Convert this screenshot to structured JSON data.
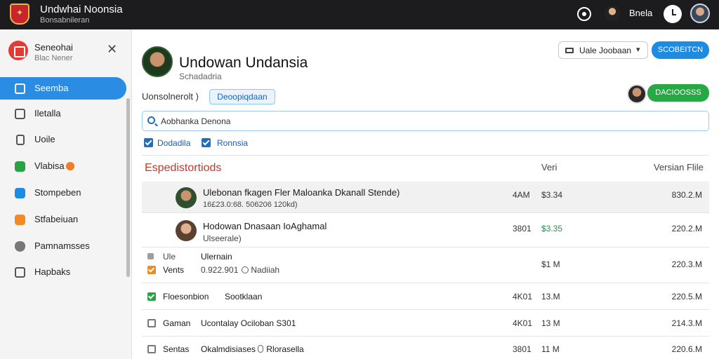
{
  "app": {
    "title": "Undwhai Noonsia",
    "subtitle": "Bonsabnileran",
    "user_label": "Bnela"
  },
  "sidebar": {
    "header_title": "Seneohai",
    "header_sub": "Blac Nener",
    "items": [
      {
        "label": "Seemba",
        "icon": "check-square-icon",
        "color": "#ffffff",
        "active": true
      },
      {
        "label": "Iletalla",
        "icon": "mail-icon",
        "color": "#555555"
      },
      {
        "label": "Uoile",
        "icon": "document-icon",
        "color": "#555555"
      },
      {
        "label": "Vlabisa",
        "icon": "checkmark-icon",
        "color": "#27a345",
        "badge": true
      },
      {
        "label": "Stompeben",
        "icon": "calendar-icon",
        "color": "#1d8ce0"
      },
      {
        "label": "Stfabeiuan",
        "icon": "tag-icon",
        "color": "#f08a24"
      },
      {
        "label": "Pamnamsses",
        "icon": "shield-icon",
        "color": "#666666"
      },
      {
        "label": "Hapbaks",
        "icon": "grid-icon",
        "color": "#555555"
      }
    ]
  },
  "main": {
    "title": "Undowan Undansia",
    "subtitle": "Schadadria",
    "dropdown_label": "Uale Joobaan",
    "primary_button": "SCOBEITCN",
    "green_button": "DACIOOSSS",
    "filter_label": "Uonsolnerolt )",
    "filter_chip": "Deoopiqdaan",
    "search_value": "Aobhanka Denona",
    "checks": [
      {
        "label": "Dodadila"
      },
      {
        "label": "Ronnsia"
      }
    ],
    "section_title": "Espedistortiods",
    "col_1": "Veri",
    "col_2": "Versian Flile"
  },
  "rows": [
    {
      "title": "Ulebonan fkagen Fler Maloanka Dkanall Stende)",
      "sub": "16£23.0:68. 506206 120kd)",
      "c1": "4AM",
      "c2": "$3.34",
      "c3": "830.2.M",
      "selected": true
    },
    {
      "title": "Hodowan Dnasaan IoAghamal",
      "sub": "Ulseerale)",
      "c1": "3801",
      "c2": "$3.35",
      "c3": "220.2.M",
      "c2_color": "#2e8b57"
    },
    {
      "label_a": "Ule",
      "label_b": "Vents",
      "title": "Ulernain",
      "sub_a": "0.922.901",
      "sub_b": "Nadiiah",
      "c2": "$1 M",
      "c3": "220.3.M"
    },
    {
      "label": "Floesonbion",
      "title": "Sootklaan",
      "c1": "4K01",
      "c2": "13.M",
      "c3": "220.5.M"
    },
    {
      "label": "Gaman",
      "title": "Ucontalay Ociloban S301",
      "c1": "4K01",
      "c2": "13 M",
      "c3": "214.3.M"
    },
    {
      "label": "Sentas",
      "title": "Okalmdisiases",
      "extra": "Rlorasella",
      "c1": "3801",
      "c2": "11 M",
      "c3": "220.6.M"
    }
  ]
}
